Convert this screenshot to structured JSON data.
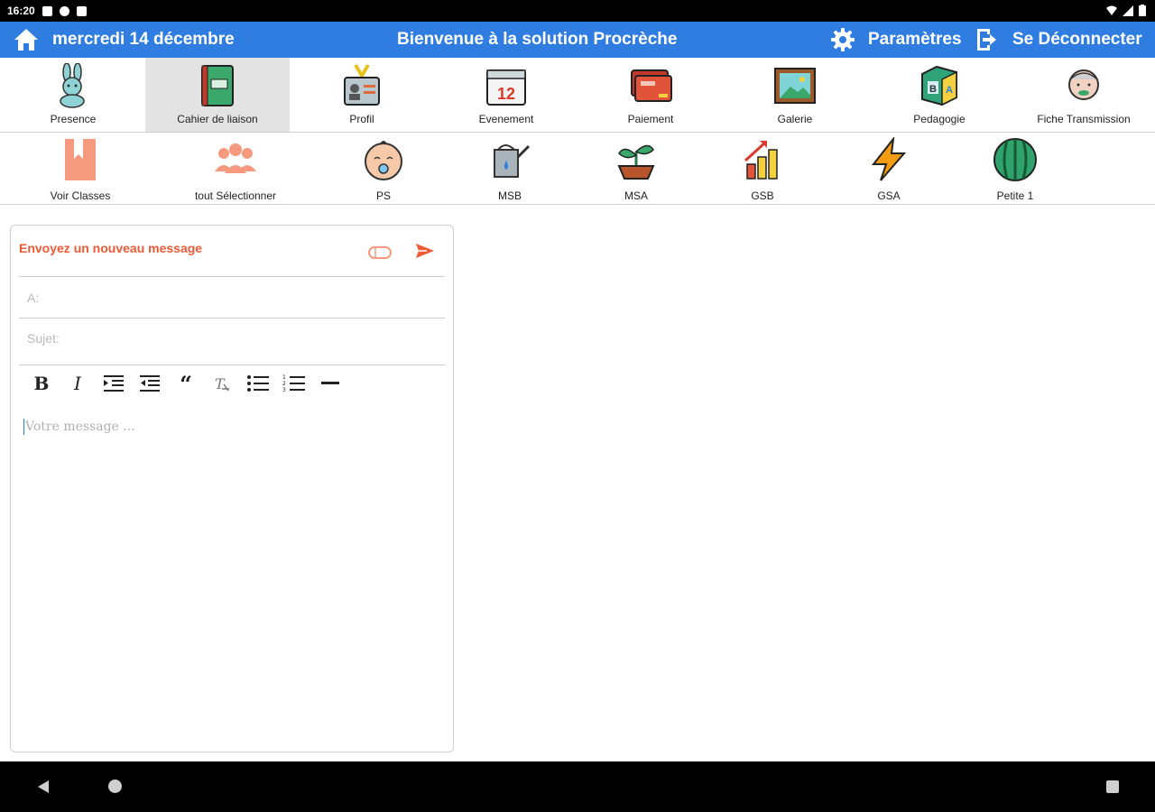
{
  "status_bar": {
    "time": "16:20"
  },
  "header": {
    "date": "mercredi 14 décembre",
    "title": "Bienvenue à la solution Procrèche",
    "settings_label": "Paramètres",
    "logout_label": "Se Déconnecter",
    "color": "#2f7de1"
  },
  "nav": {
    "items": [
      {
        "label": "Presence",
        "icon": "bunny-icon"
      },
      {
        "label": "Cahier de liaison",
        "icon": "notebook-icon"
      },
      {
        "label": "Profil",
        "icon": "id-badge-icon"
      },
      {
        "label": "Evenement",
        "icon": "calendar-icon"
      },
      {
        "label": "Paiement",
        "icon": "card-icon"
      },
      {
        "label": "Galerie",
        "icon": "picture-icon"
      },
      {
        "label": "Pedagogie",
        "icon": "blocks-icon"
      },
      {
        "label": "Fiche Transmission",
        "icon": "grandpa-icon"
      }
    ],
    "active": "Cahier de liaison",
    "calendar_number": "12"
  },
  "classes": {
    "items": [
      {
        "label": "Voir Classes",
        "icon": "bookmark-icon"
      },
      {
        "label": "tout Sélectionner",
        "icon": "group-icon"
      },
      {
        "label": "PS",
        "icon": "baby-icon"
      },
      {
        "label": "MSB",
        "icon": "watering-can-icon"
      },
      {
        "label": "MSA",
        "icon": "sprout-icon"
      },
      {
        "label": "GSB",
        "icon": "growth-chart-icon"
      },
      {
        "label": "GSA",
        "icon": "lightning-icon"
      },
      {
        "label": "Petite 1",
        "icon": "melon-icon"
      }
    ]
  },
  "compose": {
    "title": "Envoyez un nouveau message",
    "to_placeholder": "A:",
    "subject_placeholder": "Sujet:",
    "body_placeholder": "Votre message ...",
    "accent": "#ef5a35",
    "toolbar": [
      "bold",
      "italic",
      "indent",
      "outdent",
      "quote",
      "clear-format",
      "bullet-list",
      "numbered-list",
      "horizontal-rule"
    ]
  }
}
